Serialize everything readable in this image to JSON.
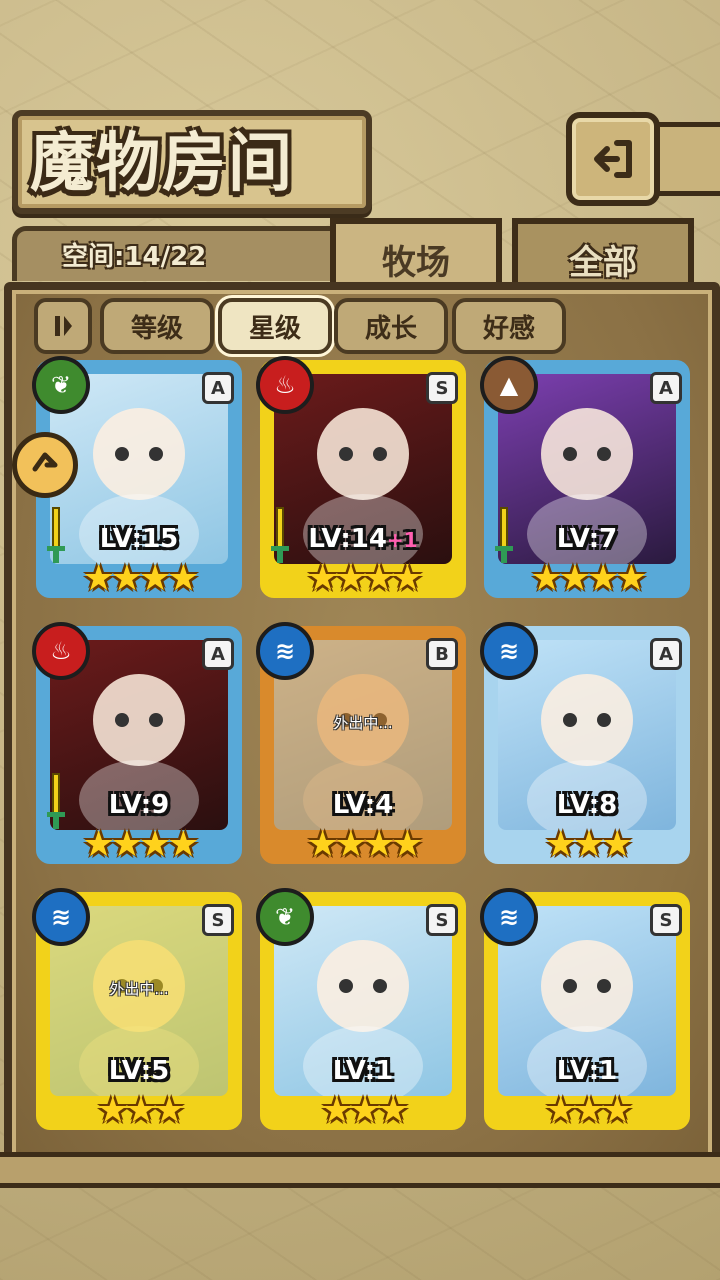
{
  "header": {
    "title": "魔物房间",
    "space_label": "空间:14/22"
  },
  "tabs": [
    {
      "label": "牧场",
      "active": true
    },
    {
      "label": "全部",
      "active": false
    }
  ],
  "filters": [
    {
      "label": "等级",
      "active": false
    },
    {
      "label": "星级",
      "active": true
    },
    {
      "label": "成长",
      "active": false
    },
    {
      "label": "好感",
      "active": false
    }
  ],
  "sort_toggle_icon": "pause-icon",
  "monsters": [
    {
      "element": "grass",
      "rank": "A",
      "level": "LV:15",
      "plus": "",
      "stars": 4,
      "stars_text": "★★★★",
      "frame": "blue",
      "away": "",
      "weapon": true
    },
    {
      "element": "fire",
      "rank": "S",
      "level": "LV:14",
      "plus": "+1",
      "stars": 4,
      "stars_text": "★★★★",
      "frame": "gold",
      "away": "",
      "weapon": true
    },
    {
      "element": "earth",
      "rank": "A",
      "level": "LV:7",
      "plus": "",
      "stars": 4,
      "stars_text": "★★★★",
      "frame": "blue",
      "away": "",
      "weapon": true
    },
    {
      "element": "fire",
      "rank": "A",
      "level": "LV:9",
      "plus": "",
      "stars": 4,
      "stars_text": "★★★★",
      "frame": "blue",
      "away": "",
      "weapon": true
    },
    {
      "element": "water",
      "rank": "B",
      "level": "LV:4",
      "plus": "",
      "stars": 4,
      "stars_text": "★★★★",
      "frame": "bronze",
      "away": "外出中...",
      "weapon": false
    },
    {
      "element": "water",
      "rank": "A",
      "level": "LV:8",
      "plus": "",
      "stars": 3,
      "stars_text": "★★★",
      "frame": "lightblue",
      "away": "",
      "weapon": false
    },
    {
      "element": "water",
      "rank": "S",
      "level": "LV:5",
      "plus": "",
      "stars": 3,
      "stars_text": "★★★",
      "frame": "gold",
      "away": "外出中...",
      "weapon": false
    },
    {
      "element": "grass",
      "rank": "S",
      "level": "LV:1",
      "plus": "",
      "stars": 3,
      "stars_text": "★★★",
      "frame": "gold",
      "away": "",
      "weapon": false
    },
    {
      "element": "water",
      "rank": "S",
      "level": "LV:1",
      "plus": "",
      "stars": 3,
      "stars_text": "★★★",
      "frame": "gold",
      "away": "",
      "weapon": false
    }
  ],
  "colors": {
    "grass": "#3f8b2e",
    "fire": "#c81e1e",
    "earth": "#8a5a34",
    "water": "#1e6fc2",
    "blue": "#58a9d8",
    "gold": "#f2d21a",
    "bronze": "#d98a2c",
    "lightblue": "#a8d4ee"
  }
}
